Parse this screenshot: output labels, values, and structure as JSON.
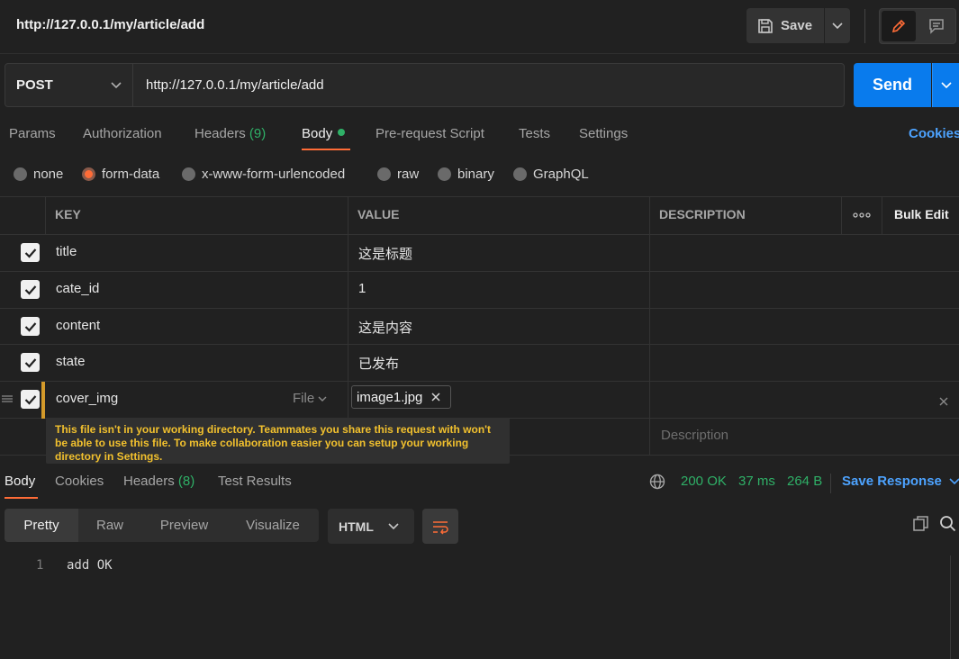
{
  "request": {
    "title": "http://127.0.0.1/my/article/add",
    "save_label": "Save",
    "method": "POST",
    "url": "http://127.0.0.1/my/article/add",
    "send_label": "Send"
  },
  "request_tabs": [
    {
      "label": "Params"
    },
    {
      "label": "Authorization"
    },
    {
      "label": "Headers",
      "count": "(9)"
    },
    {
      "label": "Body"
    },
    {
      "label": "Pre-request Script"
    },
    {
      "label": "Tests"
    },
    {
      "label": "Settings"
    }
  ],
  "cookies_label": "Cookies",
  "body_types": [
    {
      "label": "none",
      "selected": false
    },
    {
      "label": "form-data",
      "selected": true
    },
    {
      "label": "x-www-form-urlencoded",
      "selected": false
    },
    {
      "label": "raw",
      "selected": false
    },
    {
      "label": "binary",
      "selected": false
    },
    {
      "label": "GraphQL",
      "selected": false
    }
  ],
  "table": {
    "headers": {
      "key": "KEY",
      "value": "VALUE",
      "description": "DESCRIPTION",
      "bulk_edit": "Bulk Edit"
    },
    "rows": [
      {
        "key": "title",
        "value": "这是标题"
      },
      {
        "key": "cate_id",
        "value": "1"
      },
      {
        "key": "content",
        "value": "这是内容"
      },
      {
        "key": "state",
        "value": "已发布"
      },
      {
        "key": "cover_img",
        "type": "File",
        "value": "image1.jpg"
      }
    ],
    "description_placeholder": "Description",
    "file_warning": "This file isn't in your working directory. Teammates you share this request with won't be able to use this file. To make collaboration easier you can setup your working directory in Settings."
  },
  "response": {
    "tabs": [
      {
        "label": "Body"
      },
      {
        "label": "Cookies"
      },
      {
        "label": "Headers",
        "count": "(8)"
      },
      {
        "label": "Test Results"
      }
    ],
    "status": "200 OK",
    "time": "37 ms",
    "size": "264 B",
    "save_response_label": "Save Response",
    "views": [
      "Pretty",
      "Raw",
      "Preview",
      "Visualize"
    ],
    "format": "HTML",
    "lines": [
      {
        "no": "1",
        "text": "add OK"
      }
    ]
  },
  "colors": {
    "accent": "#ff6c37",
    "send": "#097bed",
    "success": "#2fb067",
    "link": "#4da3ff",
    "warning": "#f2c12e"
  }
}
